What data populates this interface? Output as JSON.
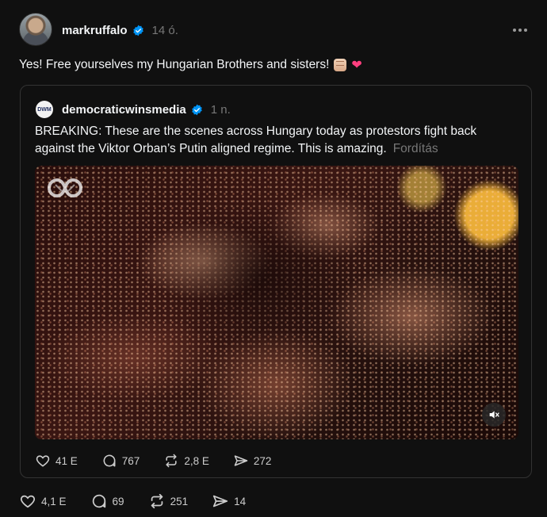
{
  "post": {
    "username": "markruffalo",
    "time": "14 ó.",
    "text": "Yes! Free yourselves my Hungarian Brothers and sisters!",
    "emojis": [
      "raised-fist",
      "pink-heart"
    ],
    "actions": {
      "likes": "4,1 E",
      "replies": "69",
      "reposts": "251",
      "shares": "14"
    }
  },
  "quoted_post": {
    "avatar_label": "DWM",
    "username": "democraticwinsmedia",
    "time": "1 n.",
    "text": "BREAKING: These are the scenes across Hungary today as protestors fight back against the Viktor Orban’s Putin aligned regime. This is amazing.",
    "translate_label": "Fordítás",
    "actions": {
      "likes": "41 E",
      "replies": "767",
      "reposts": "2,8 E",
      "shares": "272"
    }
  },
  "colors": {
    "background": "#101010",
    "text": "#f3f5f7",
    "muted": "#777777",
    "verified": "#0095f6",
    "border": "#333333"
  }
}
